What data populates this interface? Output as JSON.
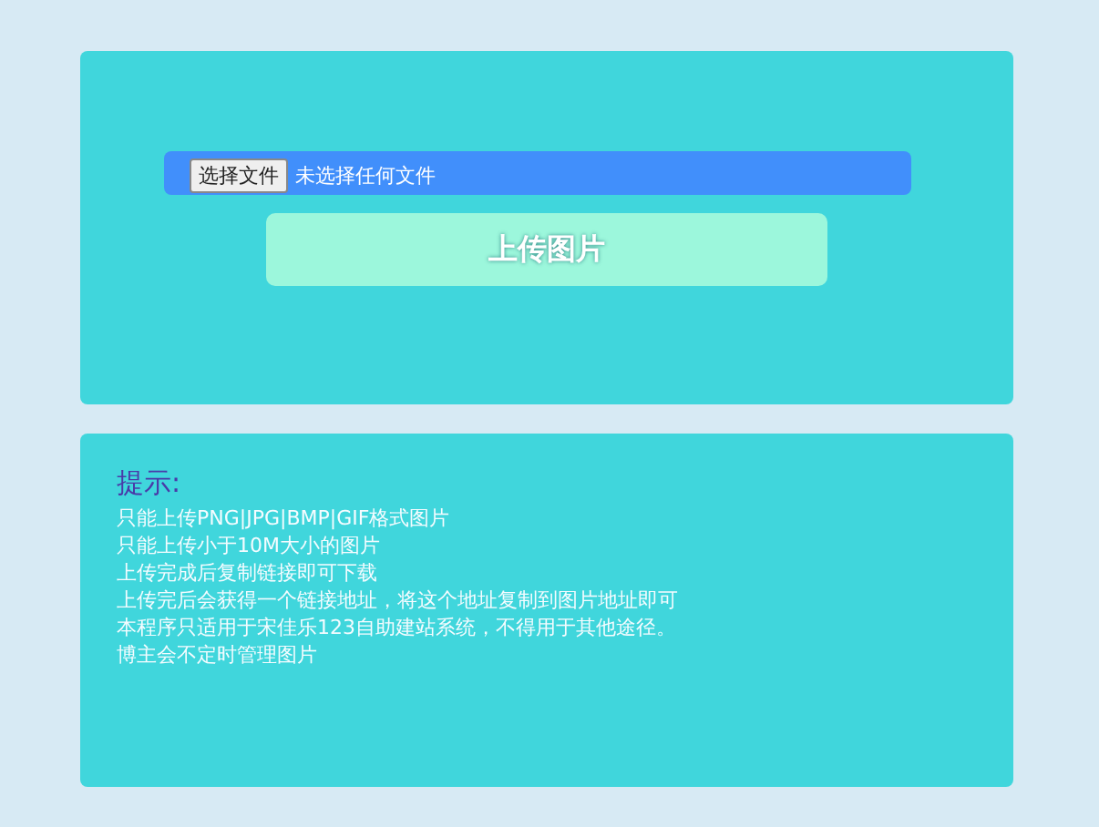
{
  "upload": {
    "file_button": "选择文件",
    "file_status": "未选择任何文件",
    "submit": "上传图片"
  },
  "tips": {
    "title": "提示:",
    "lines": [
      "只能上传PNG|JPG|BMP|GIF格式图片",
      "只能上传小于10M大小的图片",
      "上传完成后复制链接即可下载",
      "上传完后会获得一个链接地址，将这个地址复制到图片地址即可",
      "本程序只适用于宋佳乐123自助建站系统，不得用于其他途径。",
      "博主会不定时管理图片"
    ]
  }
}
